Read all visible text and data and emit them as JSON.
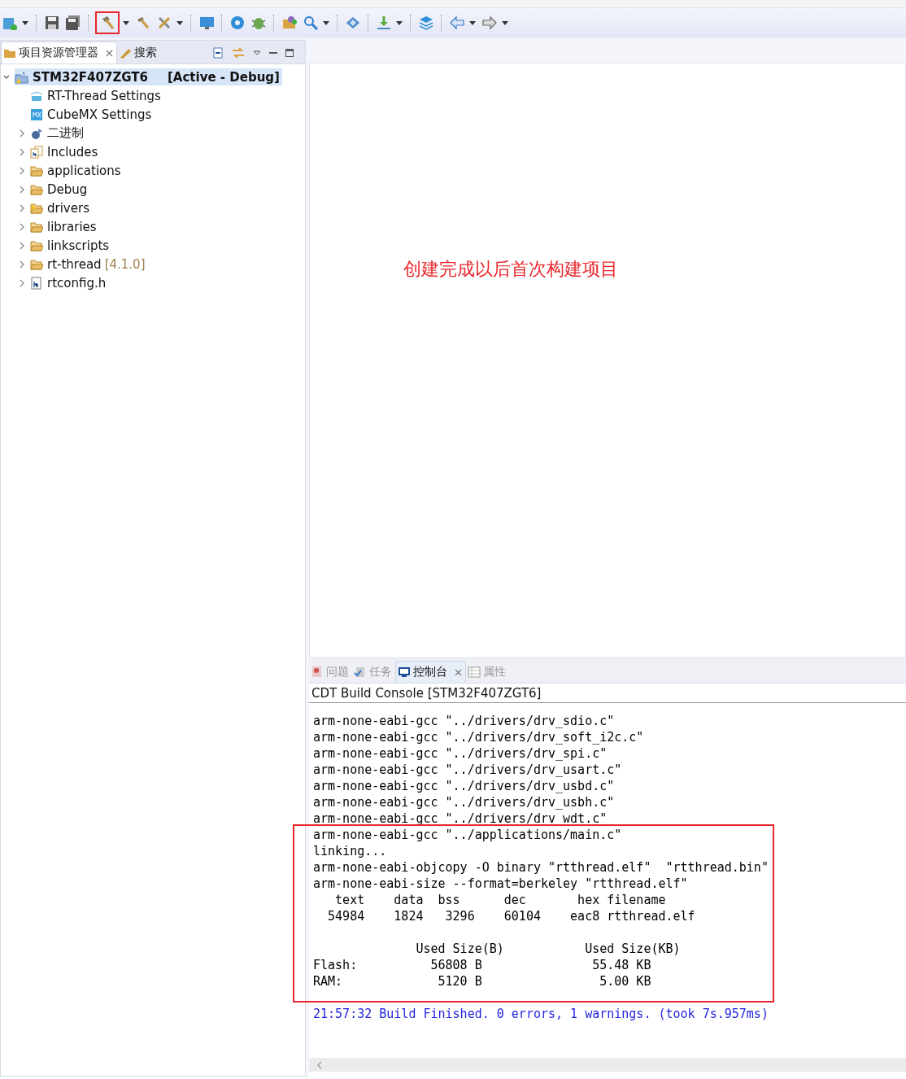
{
  "toolbar": {
    "build_highlighted": true
  },
  "explorer": {
    "tabs": [
      {
        "label": "项目资源管理器",
        "selected": true,
        "closable": true
      },
      {
        "label": "搜索",
        "selected": false,
        "closable": false
      }
    ],
    "tree": {
      "label": "STM32F407ZGT6",
      "decoration": "[Active - Debug]",
      "selected": true,
      "expanded": true,
      "children": [
        {
          "kind": "rt-settings",
          "label": "RT-Thread Settings",
          "expandable": false
        },
        {
          "kind": "mx-settings",
          "label": "CubeMX Settings",
          "expandable": false
        },
        {
          "kind": "binaries",
          "label": "二进制",
          "expandable": true
        },
        {
          "kind": "includes",
          "label": "Includes",
          "expandable": true
        },
        {
          "kind": "folder",
          "label": "applications",
          "expandable": true
        },
        {
          "kind": "folder",
          "label": "Debug",
          "expandable": true
        },
        {
          "kind": "warn-folder",
          "label": "drivers",
          "expandable": true
        },
        {
          "kind": "folder",
          "label": "libraries",
          "expandable": true
        },
        {
          "kind": "folder",
          "label": "linkscripts",
          "expandable": true
        },
        {
          "kind": "folder",
          "label": "rt-thread",
          "decoration": "[4.1.0]",
          "expandable": true
        },
        {
          "kind": "header",
          "label": "rtconfig.h",
          "expandable": true
        }
      ]
    }
  },
  "editor": {
    "annotation": "创建完成以后首次构建项目"
  },
  "console": {
    "tabs": [
      {
        "label": "问题",
        "selected": false,
        "closable": false
      },
      {
        "label": "任务",
        "selected": false,
        "closable": false
      },
      {
        "label": "控制台",
        "selected": true,
        "closable": true
      },
      {
        "label": "属性",
        "selected": false,
        "closable": false
      }
    ],
    "title": "CDT Build Console [STM32F407ZGT6]",
    "blocks": [
      {
        "kind": "output",
        "boxed": false,
        "paragraphs": [
          [
            "arm-none-eabi-gcc \"../drivers/drv_sdio.c\"",
            "arm-none-eabi-gcc \"../drivers/drv_soft_i2c.c\"",
            "arm-none-eabi-gcc \"../drivers/drv_spi.c\"",
            "arm-none-eabi-gcc \"../drivers/drv_usart.c\"",
            "arm-none-eabi-gcc \"../drivers/drv_usbd.c\"",
            "arm-none-eabi-gcc \"../drivers/drv_usbh.c\"",
            "arm-none-eabi-gcc \"../drivers/drv_wdt.c\""
          ]
        ]
      },
      {
        "kind": "output",
        "boxed": true,
        "paragraphs": [
          [
            "arm-none-eabi-gcc \"../applications/main.c\"",
            "linking...",
            "arm-none-eabi-objcopy -O binary \"rtthread.elf\"  \"rtthread.bin\"",
            "arm-none-eabi-size --format=berkeley \"rtthread.elf\"",
            "   text    data  bss      dec       hex filename",
            "  54984    1824   3296    60104    eac8 rtthread.elf"
          ],
          [
            "              Used Size(B)           Used Size(KB)",
            "Flash:          56808 B               55.48 KB",
            "RAM:             5120 B                5.00 KB"
          ]
        ]
      },
      {
        "kind": "status",
        "boxed": false,
        "paragraphs": [
          [
            "21:57:32 Build Finished. 0 errors, 1 warnings. (took 7s.957ms)"
          ]
        ]
      }
    ]
  }
}
